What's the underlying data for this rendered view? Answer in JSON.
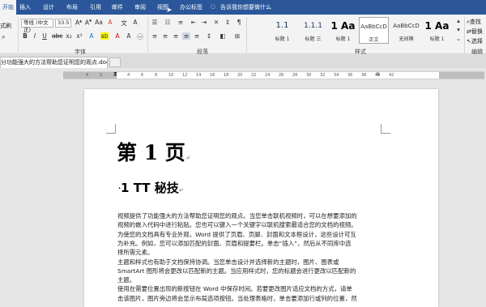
{
  "tabs": {
    "active": "开始",
    "items": [
      "插入",
      "设计",
      "布局",
      "引用",
      "邮件",
      "审阅",
      "视图",
      "办公标签"
    ],
    "tell_me": "告诉我你想要做什么"
  },
  "ribbon": {
    "format_painter": "式刷",
    "font_name": "等线 (中文正)",
    "font_size": "33.5",
    "font_group": "字体",
    "paragraph_group": "段落",
    "styles_group": "样式",
    "editing_group": "编辑",
    "find": "查找",
    "replace": "替换",
    "select": "选择",
    "styles": [
      {
        "preview": "1.1",
        "name": "标题 1"
      },
      {
        "preview": "1.1.1",
        "name": "标题 三"
      },
      {
        "preview": "1  Aa",
        "name": "标题 1"
      },
      {
        "preview": "AaBbCcD",
        "name": "正文"
      },
      {
        "preview": "AaBbCcD",
        "name": "无间隔"
      },
      {
        "preview": "1  Aa",
        "name": "标题 1"
      }
    ]
  },
  "document": {
    "tab_title": "分功能强大的方法帮助您证明您的观点.docx",
    "heading1": "第 1 页",
    "heading2_num": "1",
    "heading2_text": "TT 秘技",
    "paragraph_lines": [
      "视频提供了功能强大的方法帮助您证明您的观点。当您单击联机视频时，可以在想要添加的",
      "视频的嵌入代码中进行粘贴。您也可以键入一个关键字以联机搜索最适合您的文档的视频。",
      "为使您的文档具有专业外观，Word 提供了页眉、页脚、封面和文本框设计，这些设计可互",
      "为补充。例如，您可以添加匹配的封面、页眉和提要栏。单击“插入”，然后从不同库中选",
      "择所需元素。",
      "主题和样式也有助于文档保持协调。当您单击设计并选择新的主题时，图片、图表或",
      "SmartArt 图形将会更改以匹配新的主题。当应用样式时，您的标题会进行更改以匹配新的",
      "主题。",
      "使用在需要位置出现的新按钮在 Word 中保存时间。若要更改图片适应文档的方式，请单",
      "击该图片，图片旁边将会显示布局选项按钮。当处理表格时，单击要添加行或列的位置，然"
    ],
    "return_mark": "↵"
  },
  "ruler_numbers": [
    "4",
    "2",
    "2",
    "4",
    "6",
    "8",
    "10",
    "12",
    "14",
    "16",
    "18",
    "20",
    "22",
    "24",
    "26",
    "28",
    "30",
    "32",
    "34",
    "36",
    "38",
    "40",
    "42"
  ]
}
